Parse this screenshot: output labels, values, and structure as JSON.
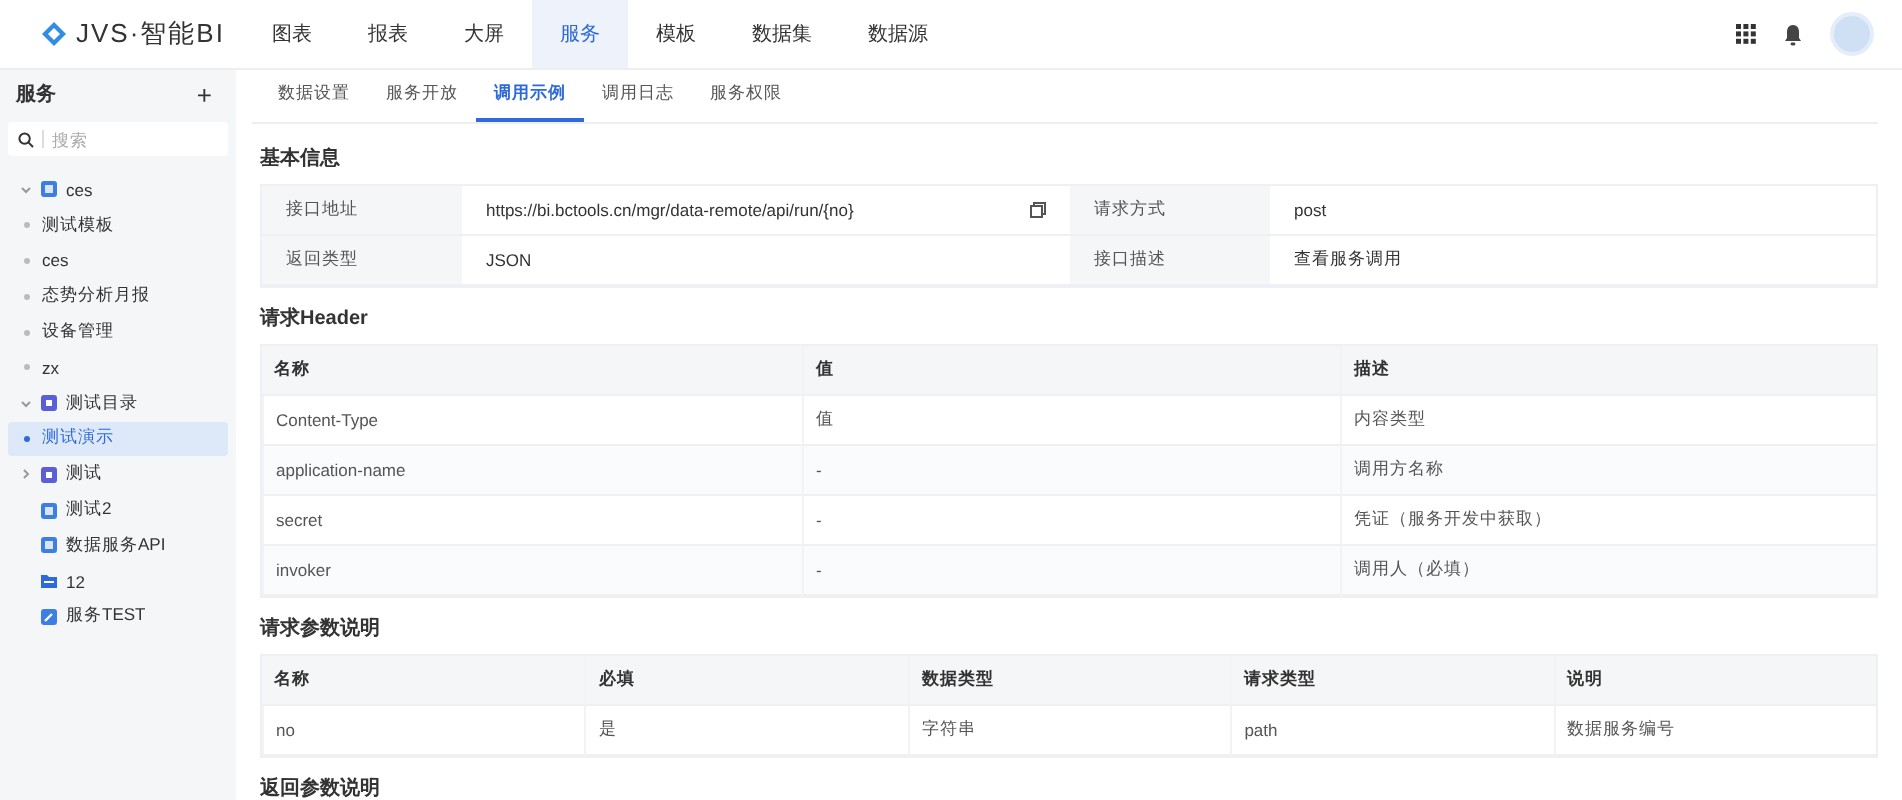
{
  "logo": {
    "text": "JVS·智能BI"
  },
  "nav": [
    {
      "label": "图表",
      "selected": false
    },
    {
      "label": "报表",
      "selected": false
    },
    {
      "label": "大屏",
      "selected": false
    },
    {
      "label": "服务",
      "selected": true
    },
    {
      "label": "模板",
      "selected": false
    },
    {
      "label": "数据集",
      "selected": false
    },
    {
      "label": "数据源",
      "selected": false
    }
  ],
  "sidebar": {
    "title": "服务",
    "add": "+",
    "search": {
      "placeholder": "搜索"
    },
    "tree": [
      {
        "label": "ces",
        "kind": "app",
        "expanded": true,
        "selected": false,
        "children": [
          {
            "label": "测试模板",
            "selected": false
          },
          {
            "label": "ces",
            "selected": false
          },
          {
            "label": "态势分析月报",
            "selected": false
          },
          {
            "label": "设备管理",
            "selected": false
          },
          {
            "label": "zx",
            "selected": false
          }
        ]
      },
      {
        "label": "测试目录",
        "kind": "catalog",
        "expanded": true,
        "selected": false,
        "children": [
          {
            "label": "测试演示",
            "selected": true
          }
        ]
      },
      {
        "label": "测试",
        "kind": "catalog",
        "expanded": false,
        "selected": false
      },
      {
        "label": "测试2",
        "kind": "app",
        "selected": false
      },
      {
        "label": "数据服务API",
        "kind": "app",
        "selected": false
      },
      {
        "label": "12",
        "kind": "folder",
        "selected": false
      },
      {
        "label": "服务TEST",
        "kind": "edit",
        "selected": false
      }
    ]
  },
  "tabs": [
    {
      "label": "数据设置",
      "selected": false
    },
    {
      "label": "服务开放",
      "selected": false
    },
    {
      "label": "调用示例",
      "selected": true
    },
    {
      "label": "调用日志",
      "selected": false
    },
    {
      "label": "服务权限",
      "selected": false
    }
  ],
  "basic_info": {
    "title": "基本信息",
    "rows": [
      {
        "label": "接口地址",
        "value": "https://bi.bctools.cn/mgr/data-remote/api/run/{no}",
        "copyable": true,
        "label_2": "请求方式",
        "value_2": "post"
      },
      {
        "label": "返回类型",
        "value": "JSON",
        "copyable": false,
        "label_2": "接口描述",
        "value_2": "查看服务调用"
      }
    ]
  },
  "header_table": {
    "title": "请求Header",
    "columns": [
      "名称",
      "值",
      "描述"
    ],
    "rows": [
      [
        "Content-Type",
        "值",
        "内容类型"
      ],
      [
        "application-name",
        "-",
        "调用方名称"
      ],
      [
        "secret",
        "-",
        "凭证（服务开发中获取）"
      ],
      [
        "invoker",
        "-",
        "调用人（必填）"
      ]
    ]
  },
  "param_table": {
    "title": "请求参数说明",
    "columns": [
      "名称",
      "必填",
      "数据类型",
      "请求类型",
      "说明"
    ],
    "rows": [
      [
        "no",
        "是",
        "字符串",
        "path",
        "数据服务编号"
      ]
    ]
  },
  "return_section": {
    "title": "返回参数说明"
  }
}
